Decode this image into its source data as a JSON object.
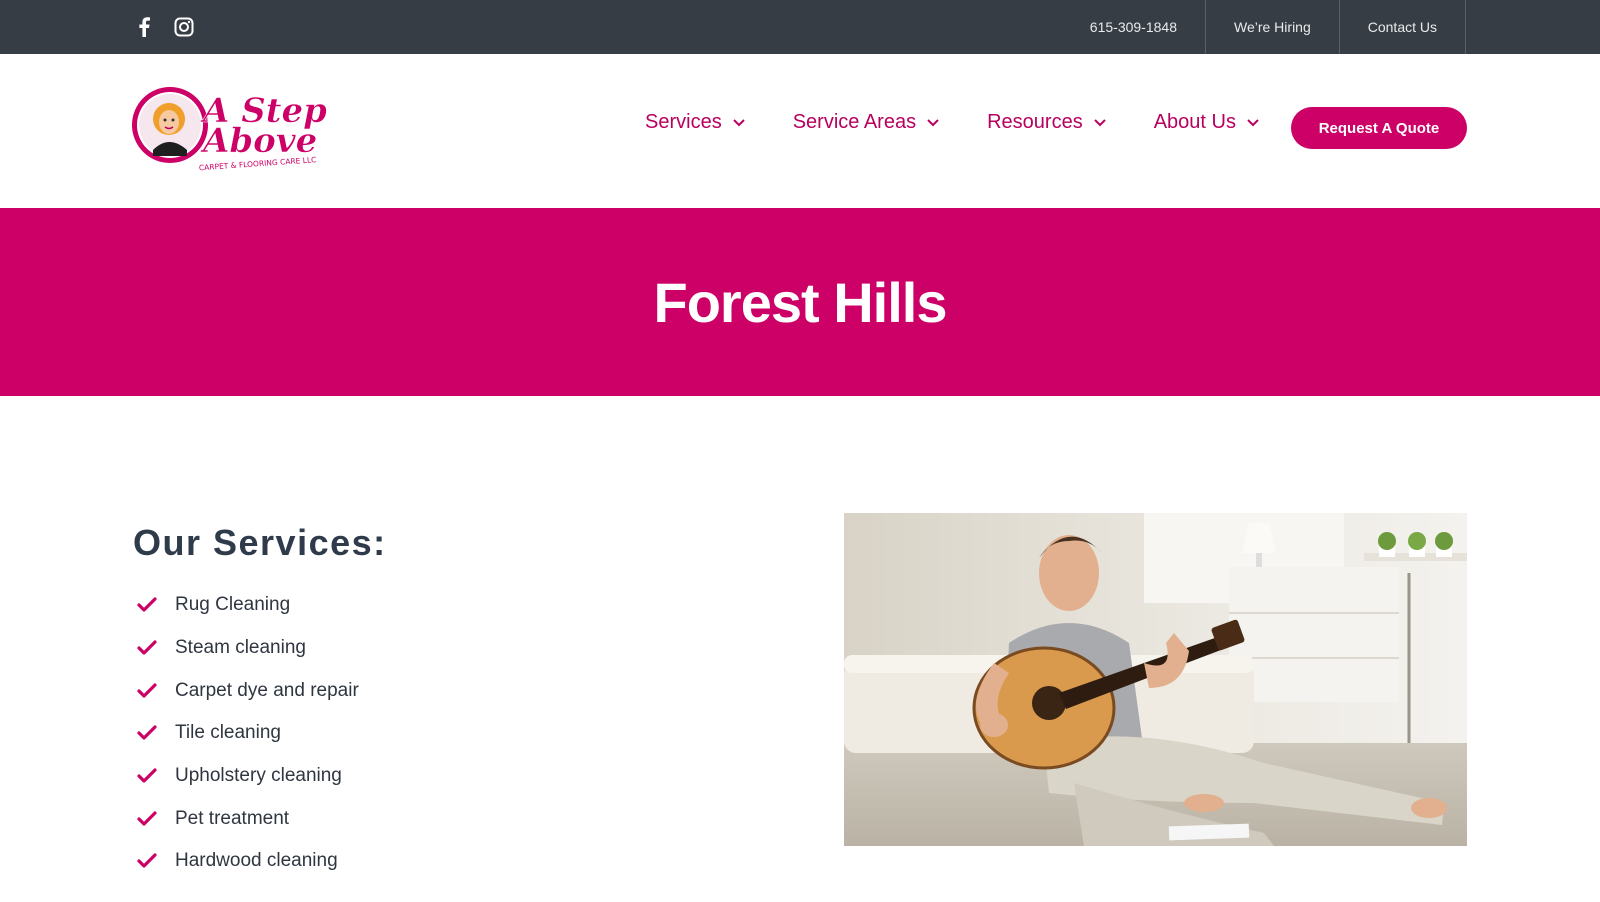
{
  "topbar": {
    "social": [
      {
        "icon": "facebook-icon"
      },
      {
        "icon": "instagram-icon"
      }
    ],
    "links": [
      {
        "label": "615-309-1848"
      },
      {
        "label": "We’re Hiring"
      },
      {
        "label": "Contact Us"
      }
    ]
  },
  "header": {
    "logo": {
      "line1": "A Step",
      "line2": "Above",
      "tagline": "CARPET & FLOORING CARE LLC"
    },
    "nav": [
      {
        "label": "Services"
      },
      {
        "label": "Service Areas"
      },
      {
        "label": "Resources"
      },
      {
        "label": "About Us"
      }
    ],
    "cta": "Request A Quote"
  },
  "hero": {
    "title": "Forest Hills"
  },
  "main": {
    "services_title": "Our Services:",
    "services": [
      "Rug Cleaning",
      "Steam cleaning",
      "Carpet dye and repair",
      "Tile cleaning",
      "Upholstery cleaning",
      "Pet treatment",
      "Hardwood cleaning"
    ]
  },
  "colors": {
    "brand": "#cc0066",
    "topbar": "#373d44",
    "nav_text": "#b8005f"
  }
}
